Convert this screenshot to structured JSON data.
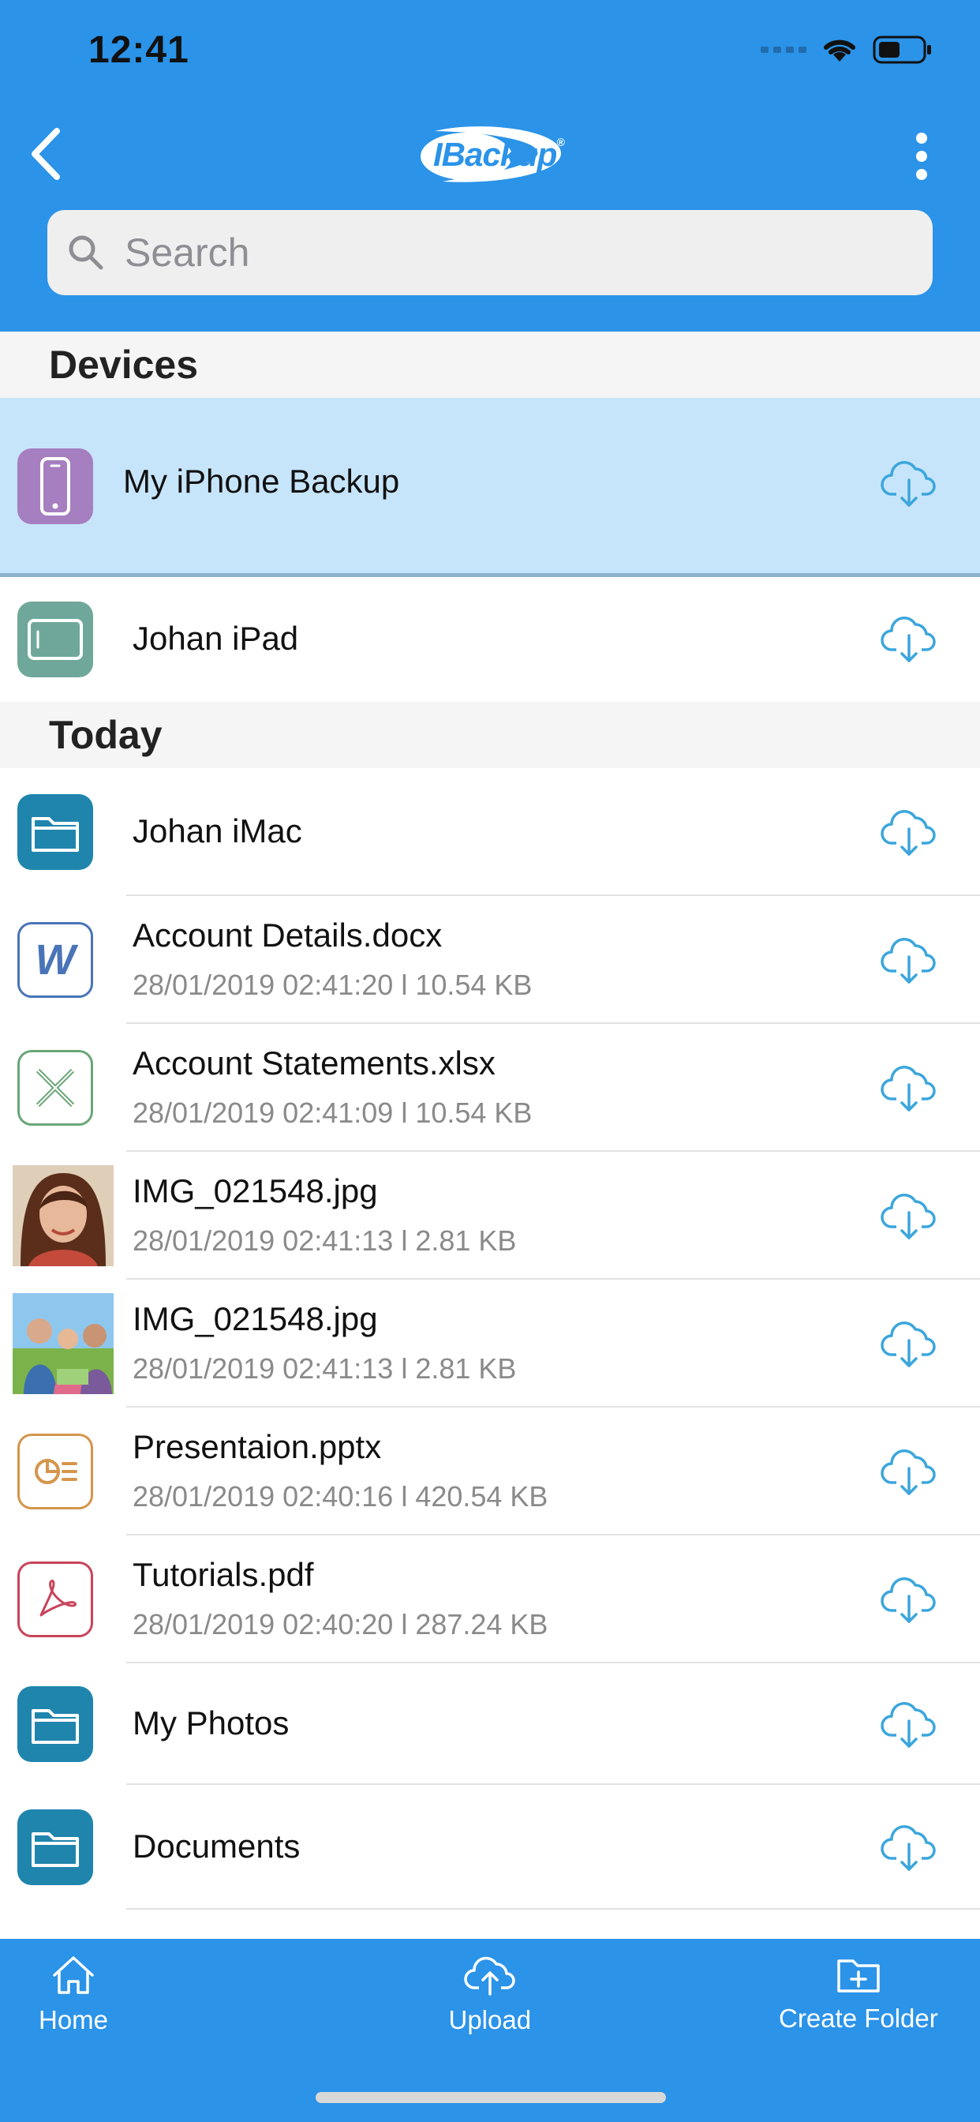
{
  "status_bar": {
    "time": "12:41"
  },
  "nav": {
    "logo_text": "IBackup",
    "logo_mark": "®",
    "back_icon": "chevron-left-icon",
    "more_icon": "more-vertical-icon"
  },
  "search": {
    "placeholder": "Search",
    "value": ""
  },
  "sections": {
    "devices": "Devices",
    "today": "Today"
  },
  "devices": [
    {
      "title": "My iPhone Backup",
      "icon": "iphone-icon",
      "icon_color": "#a57fc0",
      "selected": true
    },
    {
      "title": "Johan iPad",
      "icon": "ipad-icon",
      "icon_color": "#6fa89a",
      "selected": false
    }
  ],
  "files": [
    {
      "title": "Johan iMac",
      "subtitle": "",
      "icon": "folder-icon"
    },
    {
      "title": "Account Details.docx",
      "subtitle": "28/01/2019 02:41:20 l 10.54 KB",
      "icon": "word-doc-icon"
    },
    {
      "title": "Account Statements.xlsx",
      "subtitle": "28/01/2019 02:41:09 l 10.54 KB",
      "icon": "excel-doc-icon"
    },
    {
      "title": "IMG_021548.jpg",
      "subtitle": "28/01/2019 02:41:13 l 2.81 KB",
      "icon": "photo-thumbnail-woman"
    },
    {
      "title": "IMG_021548.jpg",
      "subtitle": "28/01/2019 02:41:13 l 2.81 KB",
      "icon": "photo-thumbnail-family"
    },
    {
      "title": "Presentaion.pptx",
      "subtitle": "28/01/2019 02:40:16 l 420.54 KB",
      "icon": "presentation-icon"
    },
    {
      "title": "Tutorials.pdf",
      "subtitle": "28/01/2019 02:40:20 l 287.24 KB",
      "icon": "pdf-icon"
    },
    {
      "title": "My Photos",
      "subtitle": "",
      "icon": "folder-icon"
    },
    {
      "title": "Documents",
      "subtitle": "",
      "icon": "folder-icon"
    }
  ],
  "tabbar": {
    "home": "Home",
    "upload": "Upload",
    "create_folder": "Create Folder"
  },
  "colors": {
    "brand_blue": "#2b93e8",
    "selected_row": "#c7e5fa",
    "folder_teal": "#1f85ad",
    "cloud_blue": "#3ba6dc"
  }
}
